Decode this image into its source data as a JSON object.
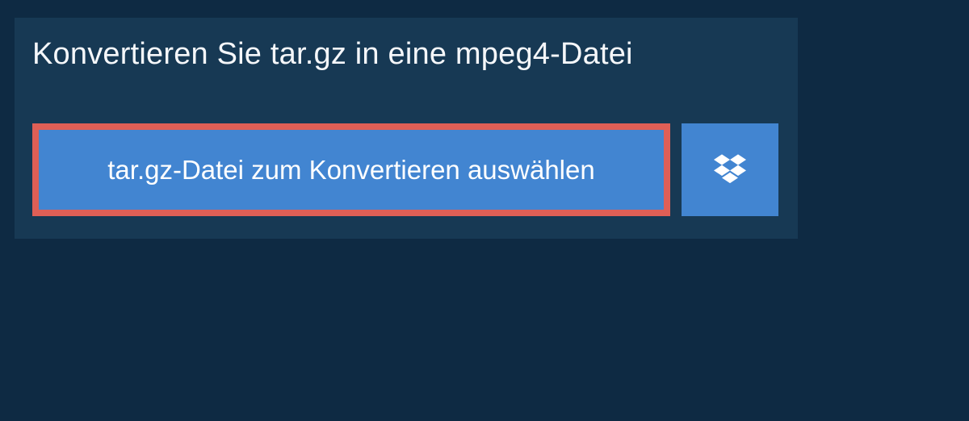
{
  "heading": "Konvertieren Sie tar.gz in eine mpeg4-Datei",
  "select_button_label": "tar.gz-Datei zum Konvertieren auswählen"
}
